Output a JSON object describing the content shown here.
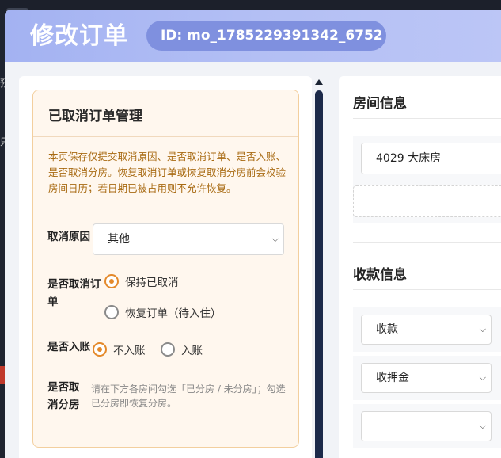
{
  "modal": {
    "title": "修改订单",
    "id_label": "ID: mo_1785229391342_6752"
  },
  "background": {
    "glyph_1": "预",
    "glyph_2": "只"
  },
  "cancel_section": {
    "title": "已取消订单管理",
    "notice": "本页保存仅提交取消原因、是否取消订单、是否入账、是否取消分房。恢复取消订单或恢复取消分房前会校验房间日历；若日期已被占用则不允许恢复。",
    "reason_label": "取消原因",
    "reason_value": "其他",
    "cancel_order_label": "是否取消订单",
    "cancel_order_options": [
      "保持已取消",
      "恢复订单（待入住）"
    ],
    "cancel_order_selected": 0,
    "post_label": "是否入账",
    "post_options": [
      "不入账",
      "入账"
    ],
    "post_selected": 0,
    "cancel_room_label": "是否取消分房",
    "cancel_room_hint": "请在下方各房间勾选「已分房 / 未分房」；勾选已分房即恢复分房。"
  },
  "room_section": {
    "title": "房间信息",
    "room_value": "4029 大床房"
  },
  "payment_section": {
    "title": "收款信息",
    "rows": [
      {
        "type": "收款"
      },
      {
        "type": "收押金"
      },
      {
        "type": ""
      }
    ]
  },
  "colors": {
    "accent": "#e4892a",
    "header_start": "#a3b2f2",
    "badge": "#7f90df",
    "notice_text": "#a86a12"
  }
}
